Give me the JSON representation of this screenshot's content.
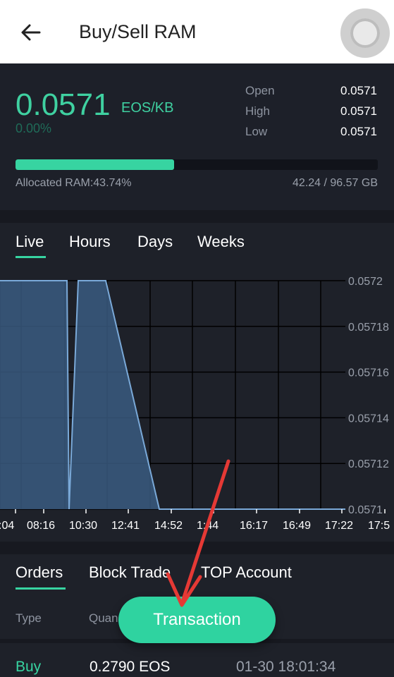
{
  "header": {
    "title": "Buy/Sell RAM"
  },
  "price": {
    "value": "0.0571",
    "unit": "EOS/KB",
    "change": "0.00%"
  },
  "stats": [
    {
      "label": "Open",
      "value": "0.0571"
    },
    {
      "label": "High",
      "value": "0.0571"
    },
    {
      "label": "Low",
      "value": "0.0571"
    }
  ],
  "ram": {
    "allocated_label": "Allocated RAM:43.74%",
    "allocated_fraction": 0.4374,
    "total": "42.24 / 96.57 GB"
  },
  "period_tabs": [
    "Live",
    "Hours",
    "Days",
    "Weeks"
  ],
  "chart_data": {
    "type": "area",
    "x": [
      ":04",
      "08:16",
      "10:30",
      "12:41",
      "14:52",
      "1:44",
      "16:17",
      "16:49",
      "17:22",
      "17:5"
    ],
    "y_ticks": [
      "0.0572",
      "0.05718",
      "0.05716",
      "0.05714",
      "0.05712",
      "0.0571"
    ],
    "ylim": [
      0.0571,
      0.0572
    ],
    "series": [
      {
        "values": [
          0.0572,
          0.0572,
          0.0571,
          0.0572,
          0.0572,
          0.0572,
          0.0571,
          0.0571,
          0.0571,
          0.0571,
          0.0571,
          0.0571,
          0.0571
        ]
      }
    ],
    "grid": true,
    "colors": {
      "line": "#7aa9d8",
      "fill": "#3a5a80"
    }
  },
  "bottom_tabs": [
    "Orders",
    "Block Trade",
    "TOP Account"
  ],
  "orders": {
    "columns": [
      "Type",
      "Quan"
    ],
    "rows": [
      {
        "type": "Buy",
        "quantity": "0.2790 EOS",
        "time": "01-30 18:01:34"
      }
    ]
  },
  "transaction_button": "Transaction",
  "colors": {
    "accent": "#37d4a1",
    "annotation": "#e53935"
  }
}
